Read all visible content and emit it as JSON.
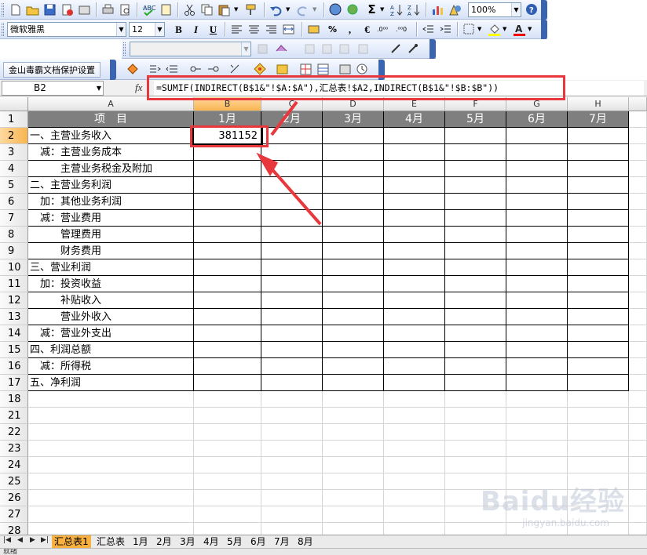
{
  "toolbar": {
    "zoom": "100%",
    "font_name": "微软雅黑",
    "font_size": "12",
    "bold": "B",
    "italic": "I",
    "underline": "U",
    "percent": "%",
    "comma": ",",
    "currency": "€",
    "sigma": "Σ",
    "wps_addin_label": "金山毒霸文档保护设置"
  },
  "formula_bar": {
    "name_box": "B2",
    "fx": "fx",
    "formula": "=SUMIF(INDIRECT(B$1&\"!$A:$A\"),汇总表!$A2,INDIRECT(B$1&\"!$B:$B\"))"
  },
  "columns": [
    "A",
    "B",
    "C",
    "D",
    "E",
    "F",
    "G",
    "H"
  ],
  "rows": [
    {
      "n": "1",
      "a": "项　目",
      "months": [
        "1月",
        "2月",
        "3月",
        "4月",
        "5月",
        "6月",
        "7月"
      ]
    },
    {
      "n": "2",
      "a": "一、主营业务收入",
      "b": "381152"
    },
    {
      "n": "3",
      "a": "　减：主营业务成本"
    },
    {
      "n": "4",
      "a": "　　　主营业务税金及附加"
    },
    {
      "n": "5",
      "a": "二、主营业务利润"
    },
    {
      "n": "6",
      "a": "　加：其他业务利润"
    },
    {
      "n": "7",
      "a": "　减：营业费用"
    },
    {
      "n": "8",
      "a": "　　　管理费用"
    },
    {
      "n": "9",
      "a": "　　　财务费用"
    },
    {
      "n": "10",
      "a": "三、营业利润"
    },
    {
      "n": "11",
      "a": "　加：投资收益"
    },
    {
      "n": "12",
      "a": "　　　补贴收入"
    },
    {
      "n": "13",
      "a": "　　　营业外收入"
    },
    {
      "n": "14",
      "a": "　减：营业外支出"
    },
    {
      "n": "15",
      "a": "四、利润总额"
    },
    {
      "n": "16",
      "a": "　减：所得税"
    },
    {
      "n": "17",
      "a": "五、净利润"
    },
    {
      "n": "18"
    },
    {
      "n": "21"
    },
    {
      "n": "22"
    },
    {
      "n": "23"
    },
    {
      "n": "24"
    },
    {
      "n": "25"
    },
    {
      "n": "26"
    },
    {
      "n": "27"
    },
    {
      "n": "28"
    }
  ],
  "sheet_tabs": [
    "汇总表1",
    "汇总表",
    "1月",
    "2月",
    "3月",
    "4月",
    "5月",
    "6月",
    "7月",
    "8月"
  ],
  "status": "就绪",
  "watermark": "Baidu经验",
  "watermark_url": "jingyan.baidu.com"
}
